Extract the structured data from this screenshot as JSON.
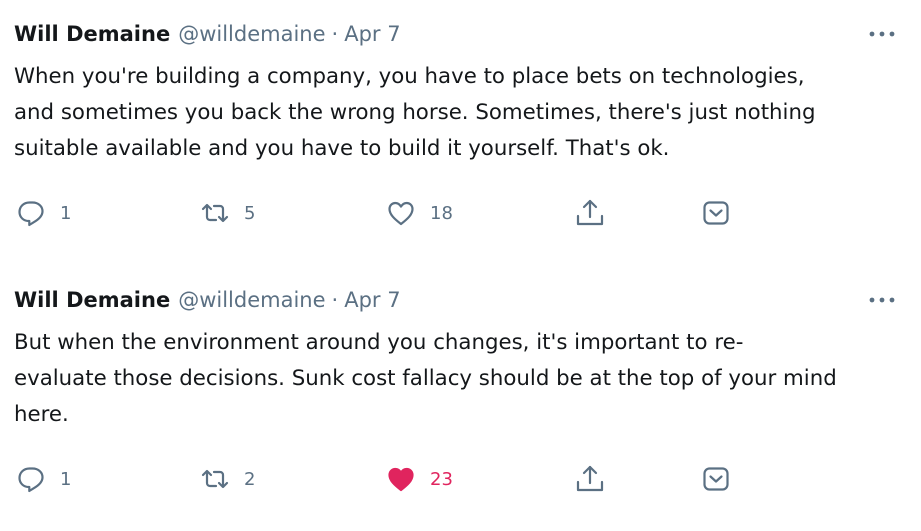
{
  "tweets": [
    {
      "author_name": "Will Demaine",
      "author_handle": "@willdemaine",
      "separator": "·",
      "date": "Apr 7",
      "text": "When you're building a company, you have to place bets on technologies,\nand sometimes you back the wrong horse. Sometimes, there's just nothing\nsuitable available and you have to build it yourself. That's ok.",
      "reply_count": "1",
      "retweet_count": "5",
      "like_count": "18",
      "liked": false
    },
    {
      "author_name": "Will Demaine",
      "author_handle": "@willdemaine",
      "separator": "·",
      "date": "Apr 7",
      "text": "But when the environment around you changes, it's important to re-\nevaluate those decisions. Sunk cost fallacy should be at the top of your mind\nhere.",
      "reply_count": "1",
      "retweet_count": "2",
      "like_count": "23",
      "liked": true
    }
  ],
  "icons": {
    "reply": "reply-icon",
    "retweet": "retweet-icon",
    "like": "heart-icon",
    "share": "share-icon",
    "save": "save-icon",
    "more": "more-icon"
  },
  "colors": {
    "text": "#14171a",
    "secondary": "#5b7083",
    "liked": "#e0245e"
  }
}
